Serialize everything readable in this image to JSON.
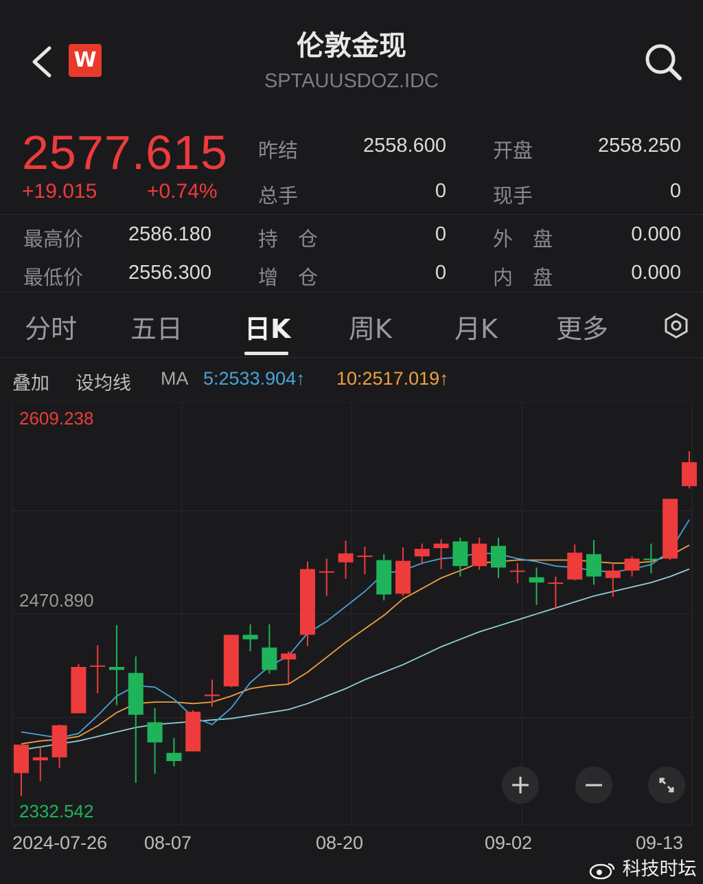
{
  "header": {
    "title": "伦敦金现",
    "code": "SPTAUUSDOZ.IDC",
    "logo_letter": "W"
  },
  "quote": {
    "price": "2577.615",
    "change": "+19.015",
    "change_pct": "+0.74%",
    "fields": [
      {
        "label": "昨结",
        "value": "2558.600"
      },
      {
        "label": "开盘",
        "value": "2558.250"
      },
      {
        "label": "总手",
        "value": "0"
      },
      {
        "label": "现手",
        "value": "0"
      },
      {
        "label": "最高价",
        "value": "2586.180"
      },
      {
        "label": "持　仓",
        "value": "0"
      },
      {
        "label": "外　盘",
        "value": "0.000"
      },
      {
        "label": "最低价",
        "value": "2556.300"
      },
      {
        "label": "增　仓",
        "value": "0"
      },
      {
        "label": "内　盘",
        "value": "0.000"
      }
    ]
  },
  "tabs": [
    "分时",
    "五日",
    "日K",
    "周K",
    "月K",
    "更多"
  ],
  "active_tab": "日K",
  "indicators": {
    "overlay": "叠加",
    "set_ma": "设均线",
    "ma_label": "MA",
    "ma5": "5:2533.904↑",
    "ma10": "10:2517.019↑"
  },
  "colors": {
    "up": "#ee3b3b",
    "down": "#1fb45a",
    "ma5": "#4aa3d8",
    "ma10": "#f0a040",
    "ma20": "#8fd0d8"
  },
  "zoom": {
    "plus": "+",
    "minus": "−"
  },
  "watermark": "科技时坛",
  "chart_data": {
    "type": "candlestick",
    "y_max_label": "2609.238",
    "y_mid_label": "2470.890",
    "y_min_label": "2332.542",
    "ylim": [
      2332.542,
      2609.238
    ],
    "x_ticks": [
      "2024-07-26",
      "08-07",
      "08-20",
      "09-02",
      "09-13"
    ],
    "candles": [
      {
        "o": 2364.5,
        "h": 2370.5,
        "l": 2349,
        "c": 2383.5
      },
      {
        "o": 2373,
        "h": 2382,
        "l": 2359,
        "c": 2375
      },
      {
        "o": 2375,
        "h": 2397,
        "l": 2368,
        "c": 2396.5
      },
      {
        "o": 2404.5,
        "h": 2437.5,
        "l": 2404.5,
        "c": 2435.5
      },
      {
        "o": 2436.5,
        "h": 2450,
        "l": 2418,
        "c": 2436.5
      },
      {
        "o": 2435.5,
        "h": 2463.5,
        "l": 2410,
        "c": 2433.5
      },
      {
        "o": 2431.5,
        "h": 2442.5,
        "l": 2358,
        "c": 2403.5
      },
      {
        "o": 2398.5,
        "h": 2408,
        "l": 2364,
        "c": 2385
      },
      {
        "o": 2378,
        "h": 2388,
        "l": 2369,
        "c": 2372.5
      },
      {
        "o": 2379,
        "h": 2406.5,
        "l": 2379,
        "c": 2405.5
      },
      {
        "o": 2416,
        "h": 2427,
        "l": 2409,
        "c": 2417
      },
      {
        "o": 2422.5,
        "h": 2457,
        "l": 2422,
        "c": 2457
      },
      {
        "o": 2457,
        "h": 2464,
        "l": 2446,
        "c": 2454
      },
      {
        "o": 2448.5,
        "h": 2464,
        "l": 2431,
        "c": 2433.5
      },
      {
        "o": 2440.5,
        "h": 2446,
        "l": 2424.5,
        "c": 2444.5
      },
      {
        "o": 2457,
        "h": 2506,
        "l": 2449.5,
        "c": 2501
      },
      {
        "o": 2499.5,
        "h": 2508,
        "l": 2483,
        "c": 2499.5
      },
      {
        "o": 2505.5,
        "h": 2520,
        "l": 2494.5,
        "c": 2511.5
      },
      {
        "o": 2510,
        "h": 2516,
        "l": 2497.5,
        "c": 2510
      },
      {
        "o": 2507,
        "h": 2511,
        "l": 2480,
        "c": 2484
      },
      {
        "o": 2484.5,
        "h": 2515.5,
        "l": 2483,
        "c": 2506.5
      },
      {
        "o": 2509.5,
        "h": 2518,
        "l": 2504,
        "c": 2514.5
      },
      {
        "o": 2515,
        "h": 2521,
        "l": 2501,
        "c": 2518
      },
      {
        "o": 2519.5,
        "h": 2522,
        "l": 2496,
        "c": 2503
      },
      {
        "o": 2503,
        "h": 2522,
        "l": 2500.5,
        "c": 2518
      },
      {
        "o": 2516.5,
        "h": 2522,
        "l": 2495,
        "c": 2502
      },
      {
        "o": 2500,
        "h": 2505,
        "l": 2491.5,
        "c": 2500
      },
      {
        "o": 2495.5,
        "h": 2502,
        "l": 2477,
        "c": 2492
      },
      {
        "o": 2492,
        "h": 2496,
        "l": 2474.5,
        "c": 2492
      },
      {
        "o": 2494,
        "h": 2517.5,
        "l": 2493.5,
        "c": 2512
      },
      {
        "o": 2511,
        "h": 2520.5,
        "l": 2490.5,
        "c": 2496
      },
      {
        "o": 2495,
        "h": 2505,
        "l": 2482.5,
        "c": 2500
      },
      {
        "o": 2500,
        "h": 2509.5,
        "l": 2496,
        "c": 2508
      },
      {
        "o": 2508,
        "h": 2518,
        "l": 2498,
        "c": 2507
      },
      {
        "o": 2508,
        "h": 2545,
        "l": 2507,
        "c": 2548
      },
      {
        "o": 2556.5,
        "h": 2580,
        "l": 2555,
        "c": 2572.5
      }
    ],
    "ma5": [
      2392,
      2390,
      2388,
      2391,
      2403,
      2416,
      2423,
      2422,
      2414,
      2402,
      2397,
      2408,
      2425,
      2436,
      2443,
      2458,
      2466,
      2476,
      2486,
      2498,
      2500,
      2505,
      2508,
      2509,
      2512,
      2511,
      2508,
      2506,
      2503,
      2502,
      2500,
      2499,
      2501,
      2504,
      2513,
      2534
    ],
    "ma10": [
      2384,
      2386,
      2387,
      2389,
      2396,
      2405,
      2411,
      2412,
      2412,
      2411,
      2412,
      2416,
      2421,
      2423,
      2424,
      2432,
      2442,
      2452,
      2461,
      2470,
      2481,
      2488,
      2495,
      2500,
      2505,
      2506,
      2507,
      2507,
      2507,
      2507,
      2506,
      2505,
      2505,
      2506,
      2510,
      2517
    ],
    "ma20": [
      2380,
      2382,
      2384,
      2386,
      2389,
      2392,
      2395,
      2397,
      2398,
      2399,
      2400,
      2401,
      2403,
      2405,
      2407,
      2411,
      2416,
      2421,
      2427,
      2432,
      2437,
      2443,
      2449,
      2454,
      2459,
      2463,
      2467,
      2471,
      2475,
      2479,
      2483,
      2486,
      2489,
      2492,
      2496,
      2501
    ]
  }
}
